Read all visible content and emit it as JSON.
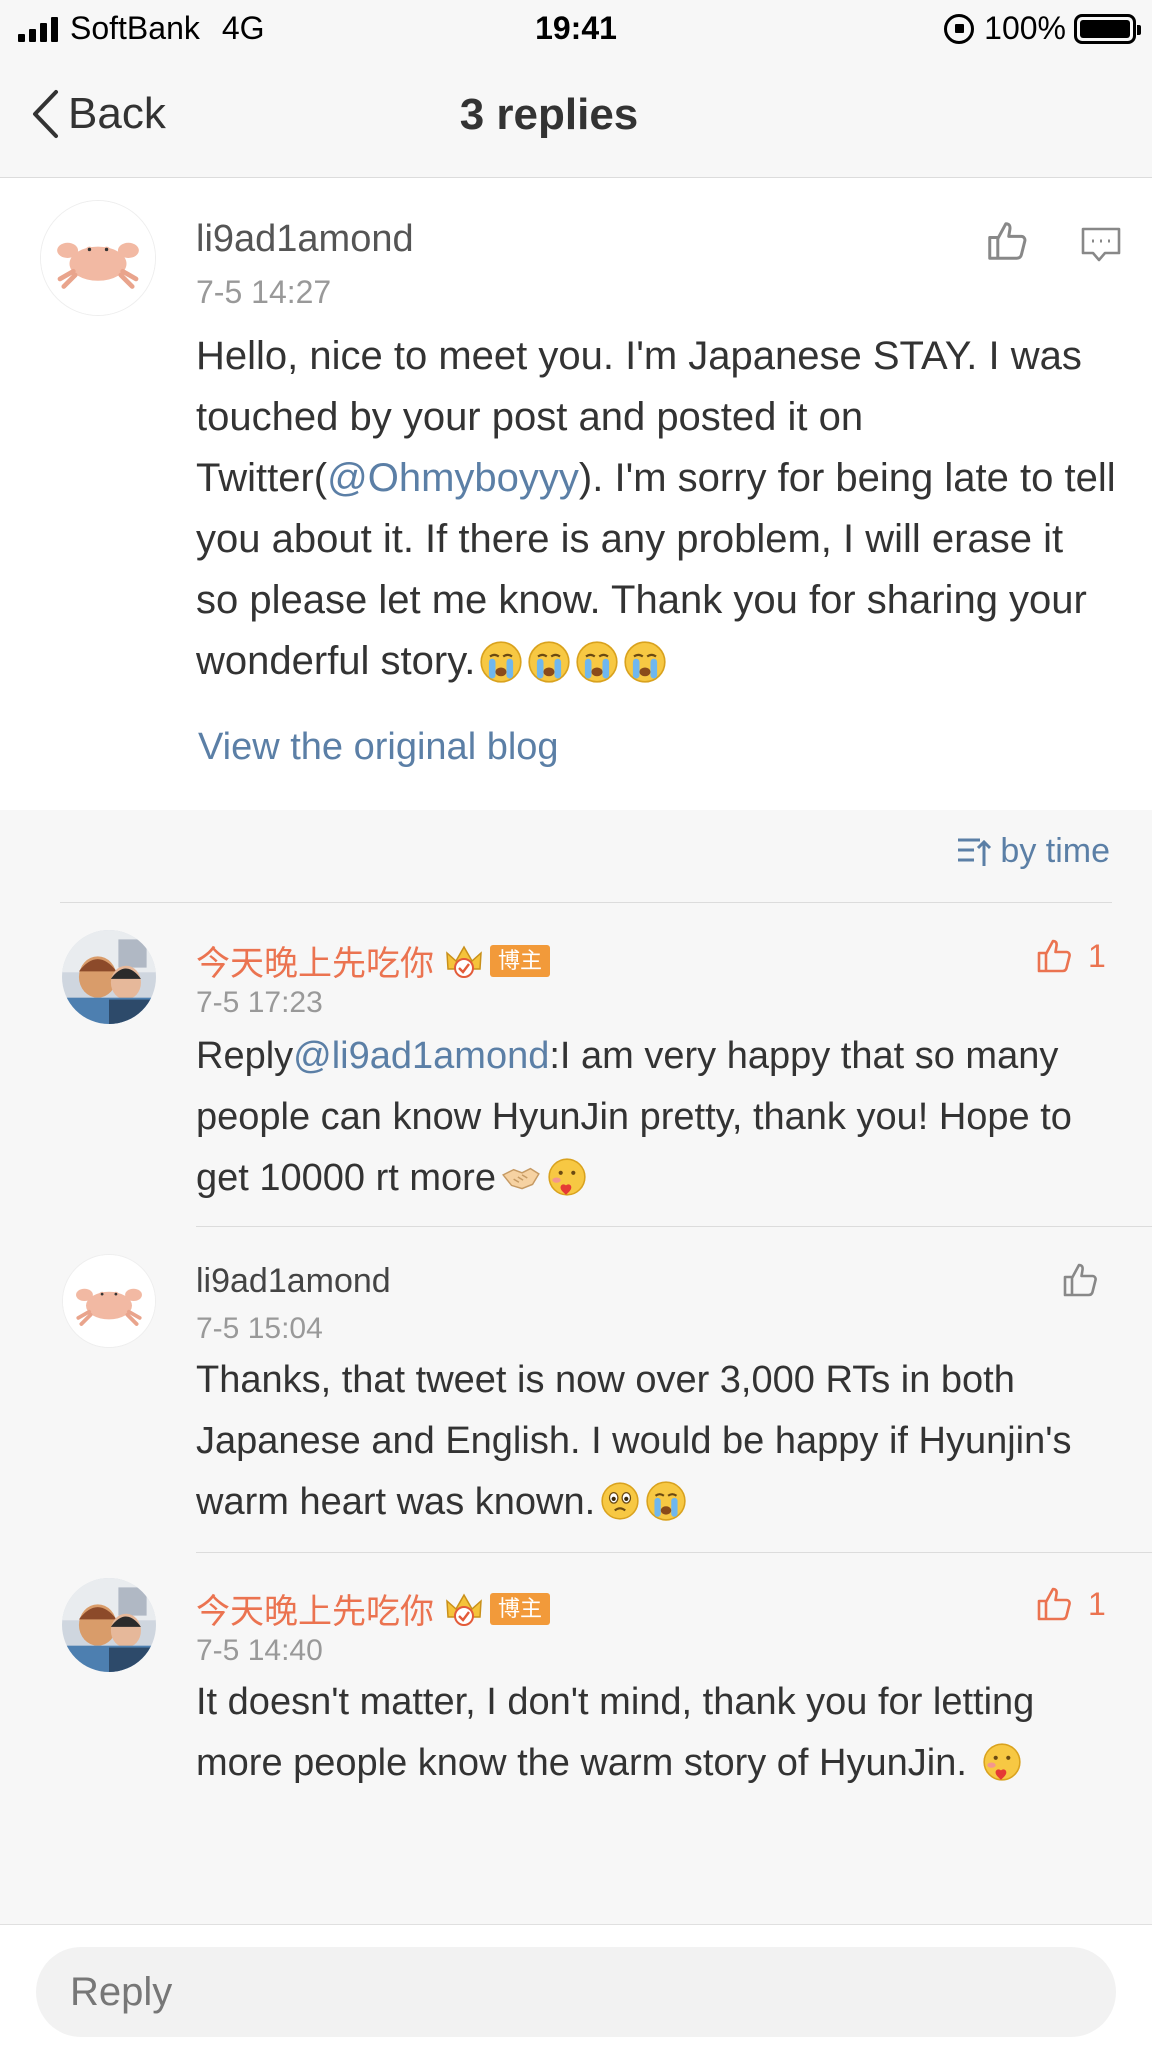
{
  "status_bar": {
    "carrier": "SoftBank",
    "network": "4G",
    "time": "19:41",
    "battery": "100%"
  },
  "nav": {
    "back_label": "Back",
    "title": "3 replies"
  },
  "main_post": {
    "username": "li9ad1amond",
    "time": "7-5 14:27",
    "text_before_mention": "Hello, nice to meet you. I'm Japanese STAY. I was touched by your post and posted it on Twitter(",
    "mention": "@Ohmyboyyy",
    "text_after_mention": "). I'm sorry for being late to tell you about it. If there is any problem, I will erase it so please let me know.  Thank you for sharing your wonderful story.",
    "emojis": [
      "crying-face",
      "crying-face",
      "crying-face",
      "crying-face"
    ],
    "view_original_label": "View the original blog"
  },
  "sort": {
    "label": "by time"
  },
  "replies": [
    {
      "username": "今天晚上先吃你",
      "is_owner": true,
      "badge": "博主",
      "time": "7-5 17:23",
      "text_prefix": "Reply",
      "mention": "@li9ad1amond",
      "text": ":I am very happy that so many people can know HyunJin pretty, thank you! Hope to get 10000 rt more",
      "emojis": [
        "handshake",
        "kiss-face"
      ],
      "likes": "1"
    },
    {
      "username": "li9ad1amond",
      "is_owner": false,
      "time": "7-5 15:04",
      "text": "Thanks, that tweet is now over 3,000 RTs in both Japanese and English.  I would be happy if Hyunjin's warm heart was known.",
      "emojis": [
        "teary-face",
        "crying-face"
      ]
    },
    {
      "username": "今天晚上先吃你",
      "is_owner": true,
      "badge": "博主",
      "time": "7-5 14:40",
      "text": "It doesn't matter, I don't mind, thank you for letting more people know the warm story of HyunJin.",
      "emojis": [
        "kiss-face"
      ],
      "likes": "1"
    }
  ],
  "bottom": {
    "reply_placeholder": "Reply"
  },
  "colors": {
    "link_blue": "#5b7fa6",
    "owner_orange": "#eb7350",
    "badge_orange": "#f29a3a"
  }
}
